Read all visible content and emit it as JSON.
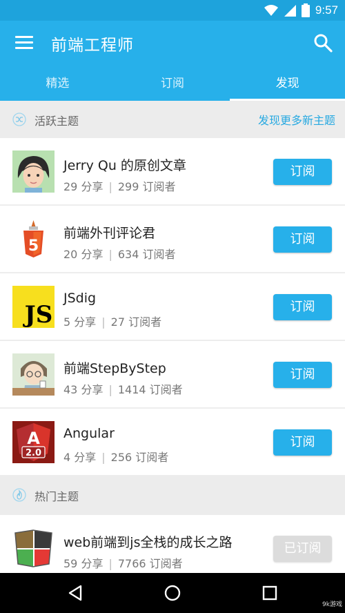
{
  "status": {
    "time": "9:57"
  },
  "app": {
    "title": "前端工程师"
  },
  "tabs": [
    {
      "label": "精选"
    },
    {
      "label": "订阅"
    },
    {
      "label": "发现"
    }
  ],
  "active_section": {
    "title": "活跃主题",
    "link": "发现更多新主题"
  },
  "hot_section": {
    "title": "热门主题"
  },
  "items": [
    {
      "name": "Jerry Qu 的原创文章",
      "shares": "29 分享",
      "subs": "299 订阅者",
      "button": "订阅"
    },
    {
      "name": "前端外刊评论君",
      "shares": "20 分享",
      "subs": "634 订阅者",
      "button": "订阅"
    },
    {
      "name": "JSdig",
      "shares": "5 分享",
      "subs": "27 订阅者",
      "button": "订阅"
    },
    {
      "name": "前端StepByStep",
      "shares": "43 分享",
      "subs": "1414 订阅者",
      "button": "订阅"
    },
    {
      "name": "Angular",
      "shares": "4 分享",
      "subs": "256 订阅者",
      "button": "订阅"
    }
  ],
  "hot_items": [
    {
      "name": "web前端到js全栈的成长之路",
      "shares": "59 分享",
      "subs": "7766 订阅者",
      "button": "已订阅"
    }
  ],
  "avatars": {
    "js_text": "JS",
    "angular_text": "A",
    "angular_version": "2.0",
    "html5_text": "5"
  },
  "watermark": {
    "text": "9k游戏"
  },
  "colors": {
    "accent": "#27b0ea",
    "statusbar": "#1ea3dc",
    "link": "#27a9e1"
  }
}
